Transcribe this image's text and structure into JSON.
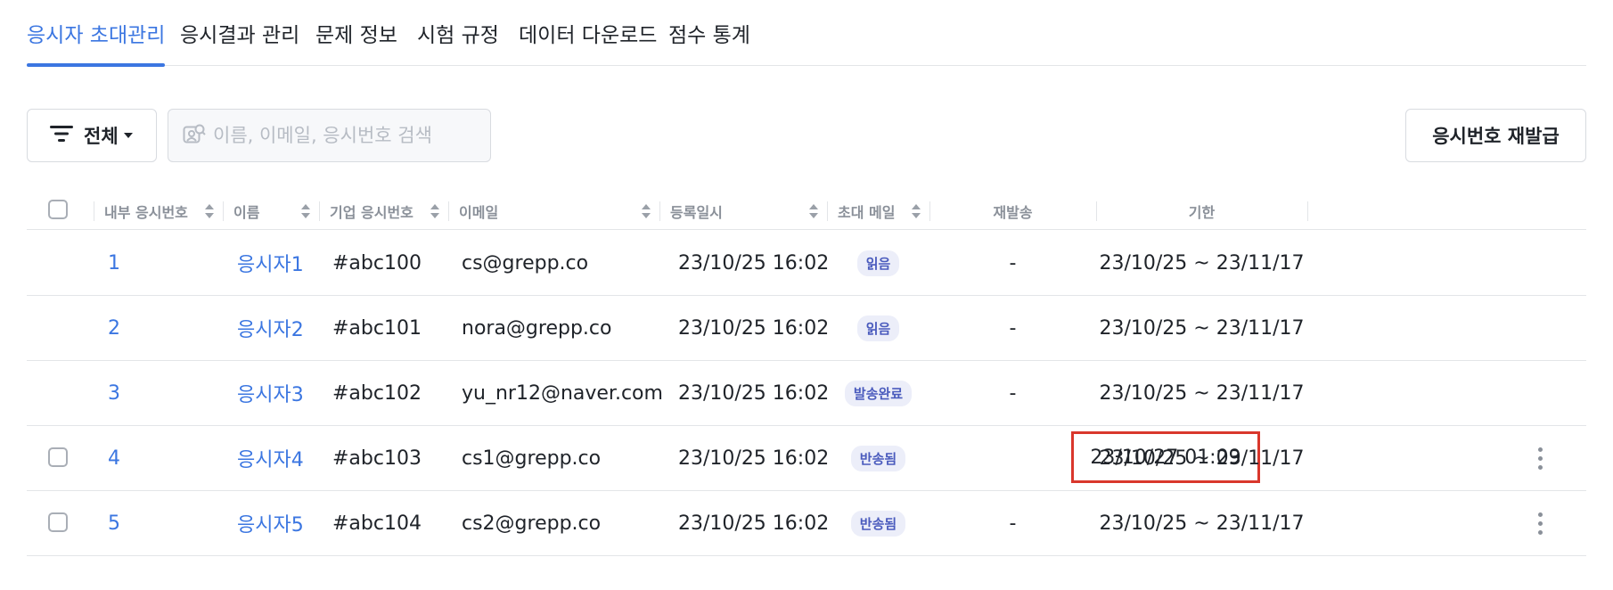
{
  "tabs": [
    {
      "label": "응시자 초대관리",
      "active": true
    },
    {
      "label": "응시결과 관리"
    },
    {
      "label": "문제 정보"
    },
    {
      "label": "시험 규정"
    },
    {
      "label": "데이터 다운로드"
    },
    {
      "label": "점수 통계"
    }
  ],
  "toolbar": {
    "filter_label": "전체",
    "search_placeholder": "이름, 이메일, 응시번호 검색",
    "reissue_label": "응시번호 재발급"
  },
  "table": {
    "columns": [
      "내부 응시번호",
      "이름",
      "기업 응시번호",
      "이메일",
      "등록일시",
      "초대 메일",
      "재발송",
      "기한"
    ],
    "rows": [
      {
        "id": "1",
        "name": "응시자1",
        "corp_id": "#abc100",
        "email": "cs@grepp.co",
        "registered": "23/10/25 16:02",
        "mail_status": "읽음",
        "resend": "-",
        "period": "23/10/25 ~ 23/11/17",
        "checkbox": false,
        "menu": false
      },
      {
        "id": "2",
        "name": "응시자2",
        "corp_id": "#abc101",
        "email": "nora@grepp.co",
        "registered": "23/10/25 16:02",
        "mail_status": "읽음",
        "resend": "-",
        "period": "23/10/25 ~ 23/11/17",
        "checkbox": false,
        "menu": false
      },
      {
        "id": "3",
        "name": "응시자3",
        "corp_id": "#abc102",
        "email": "yu_nr12@naver.com",
        "registered": "23/10/25 16:02",
        "mail_status": "발송완료",
        "resend": "-",
        "period": "23/10/25 ~ 23/11/17",
        "checkbox": false,
        "menu": false
      },
      {
        "id": "4",
        "name": "응시자4",
        "corp_id": "#abc103",
        "email": "cs1@grepp.co",
        "registered": "23/10/25 16:02",
        "mail_status": "반송됨",
        "resend": "23/10/27 01:09",
        "period": "23/10/25 ~ 23/11/17",
        "checkbox": true,
        "menu": true,
        "highlight_resend": true
      },
      {
        "id": "5",
        "name": "응시자5",
        "corp_id": "#abc104",
        "email": "cs2@grepp.co",
        "registered": "23/10/25 16:02",
        "mail_status": "반송됨",
        "resend": "-",
        "period": "23/10/25 ~ 23/11/17",
        "checkbox": true,
        "menu": true
      }
    ]
  },
  "colors": {
    "accent": "#3b76e1",
    "highlight_border": "#d9372c",
    "badge_bg": "#eceef9",
    "badge_text": "#4a5bbd"
  }
}
